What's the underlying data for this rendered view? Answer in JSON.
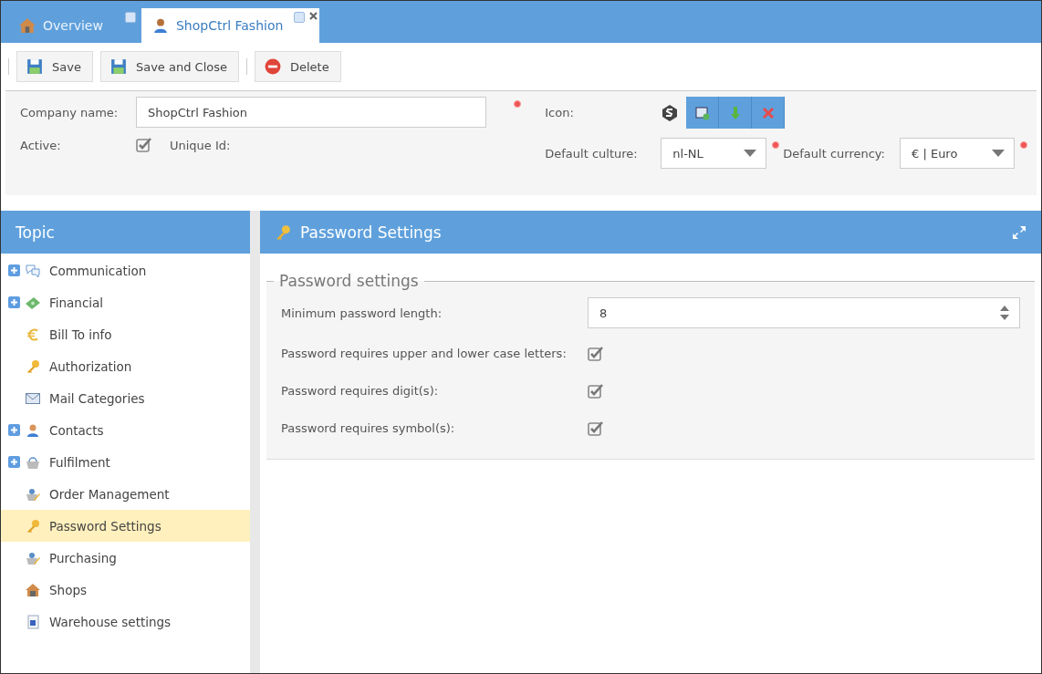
{
  "tabs": [
    {
      "label": "Overview",
      "selected": false,
      "closable": false
    },
    {
      "label": "ShopCtrl Fashion",
      "selected": true,
      "closable": true
    }
  ],
  "toolbar": [
    {
      "kind": "separator"
    },
    {
      "label": "Save",
      "kind": "save"
    },
    {
      "label": "Save and Close",
      "kind": "save"
    },
    {
      "kind": "separator"
    },
    {
      "label": "Delete",
      "kind": "delete"
    }
  ],
  "form": {
    "company_name_label": "Company name:",
    "company_name_value": "ShopCtrl Fashion",
    "active_label": "Active:",
    "active_checked": true,
    "unique_id_label": "Unique Id:",
    "icon_label": "Icon:",
    "culture_label": "Default culture:",
    "culture_value": "nl-NL",
    "currency_label": "Default currency:",
    "currency_value": "€ | Euro"
  },
  "sidebar": {
    "title": "Topic",
    "items": [
      {
        "label": "Communication",
        "expandable": true,
        "selected": false
      },
      {
        "label": "Financial",
        "expandable": true,
        "selected": false
      },
      {
        "label": "Bill To info",
        "expandable": false,
        "selected": false
      },
      {
        "label": "Authorization",
        "expandable": false,
        "selected": false
      },
      {
        "label": "Mail Categories",
        "expandable": false,
        "selected": false
      },
      {
        "label": "Contacts",
        "expandable": true,
        "selected": false
      },
      {
        "label": "Fulfilment",
        "expandable": true,
        "selected": false
      },
      {
        "label": "Order Management",
        "expandable": false,
        "selected": false
      },
      {
        "label": "Password Settings",
        "expandable": false,
        "selected": true
      },
      {
        "label": "Purchasing",
        "expandable": false,
        "selected": false
      },
      {
        "label": "Shops",
        "expandable": false,
        "selected": false
      },
      {
        "label": "Warehouse settings",
        "expandable": false,
        "selected": false
      }
    ]
  },
  "panel": {
    "title": "Password Settings",
    "group_title": "Password settings",
    "min_length_label": "Minimum password length:",
    "min_length_value": "8",
    "options": [
      {
        "label": "Password requires upper and lower case letters:",
        "checked": true
      },
      {
        "label": "Password requires digit(s):",
        "checked": true
      },
      {
        "label": "Password requires symbol(s):",
        "checked": true
      }
    ]
  }
}
